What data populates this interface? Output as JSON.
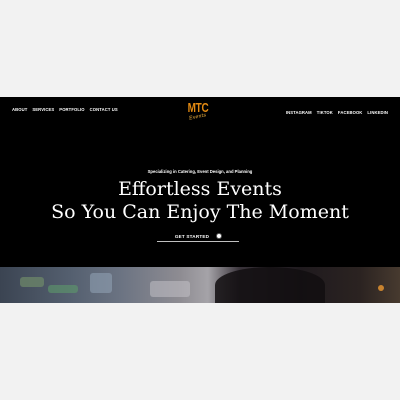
{
  "nav": {
    "left": [
      "ABOUT",
      "SERVICES",
      "PORTFOLIO",
      "CONTACT US"
    ],
    "right": [
      "INSTAGRAM",
      "TIKTOK",
      "FACEBOOK",
      "LINKEDIN"
    ]
  },
  "logo": {
    "text": "MTC",
    "script": "Events"
  },
  "hero": {
    "subtitle": "Specializing in Catering, Event Design, and Planning",
    "title_line1": "Effortless Events",
    "title_line2": "So You Can Enjoy The Moment",
    "cta_label": "GET STARTED"
  },
  "colors": {
    "background": "#000000",
    "logo_orange": "#e38a12",
    "text": "#ffffff"
  }
}
